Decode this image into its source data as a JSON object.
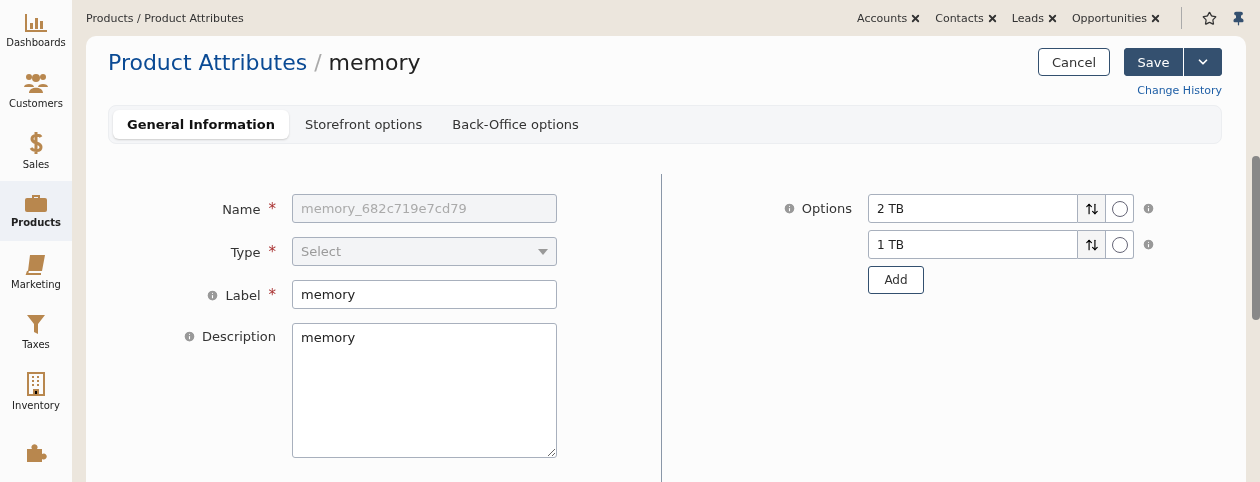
{
  "sidebar": {
    "items": [
      {
        "label": "Dashboards",
        "kind": "chart",
        "selected": false
      },
      {
        "label": "Customers",
        "kind": "people",
        "selected": false
      },
      {
        "label": "Sales",
        "kind": "dollar",
        "selected": false
      },
      {
        "label": "Products",
        "kind": "briefcase",
        "selected": true
      },
      {
        "label": "Marketing",
        "kind": "book",
        "selected": false
      },
      {
        "label": "Taxes",
        "kind": "funnel",
        "selected": false
      },
      {
        "label": "Inventory",
        "kind": "building",
        "selected": false
      },
      {
        "kind": "puzzle",
        "selected": false
      }
    ]
  },
  "breadcrumb": "Products / Product Attributes",
  "recent_tabs": [
    {
      "label": "Accounts"
    },
    {
      "label": "Contacts"
    },
    {
      "label": "Leads"
    },
    {
      "label": "Opportunities"
    }
  ],
  "header": {
    "title_link": "Product Attributes",
    "separator": "/",
    "title": "memory",
    "cancel": "Cancel",
    "save": "Save",
    "change_history": "Change History"
  },
  "tabs": [
    {
      "label": "General Information",
      "selected": true
    },
    {
      "label": "Storefront options",
      "selected": false
    },
    {
      "label": "Back-Office options",
      "selected": false
    }
  ],
  "fields": [
    {
      "kind": "text",
      "label": "Name",
      "required_mark": "*",
      "info": false,
      "disabled": true,
      "value": "memory_682c719e7cd79"
    },
    {
      "kind": "select",
      "label": "Type",
      "required_mark": "*",
      "info": false,
      "disabled": true,
      "placeholder": "Select"
    },
    {
      "kind": "text",
      "label": "Label",
      "required_mark": "*",
      "info": true,
      "disabled": false,
      "value": "memory"
    },
    {
      "kind": "textarea",
      "label": "Description",
      "info": true,
      "value": "memory"
    }
  ],
  "options": {
    "label": "Options",
    "items": [
      {
        "value": "2 TB",
        "selected": false
      },
      {
        "value": "1 TB",
        "selected": false
      }
    ],
    "add": "Add"
  }
}
